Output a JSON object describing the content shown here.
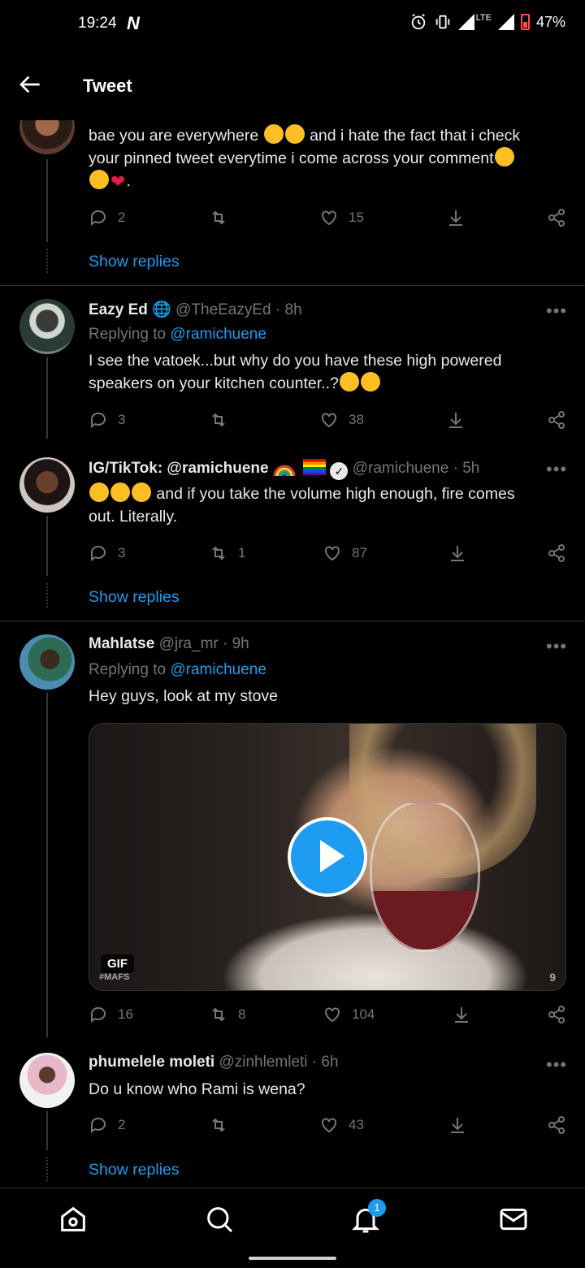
{
  "status_bar": {
    "time": "19:24",
    "network_label": "LTE",
    "battery": "47%"
  },
  "header": {
    "title": "Tweet"
  },
  "colors": {
    "accent": "#1d9bf0",
    "background": "#000000",
    "muted": "#71767b"
  },
  "tweets": [
    {
      "text_line1": "bae you are everywhere",
      "text_line1b": "and i hate the fact that i check",
      "text_line2": "your pinned tweet everytime i come across your comment",
      "text_line3": ".",
      "replies": "2",
      "retweets": "",
      "likes": "15",
      "show_replies": "Show replies"
    },
    {
      "name": "Eazy Ed",
      "handle": "@TheEazyEd",
      "time": "· 8h",
      "replying_prefix": "Replying to",
      "replying_to": "@ramichuene",
      "text": "I see the vatoek...but why do you have these high powered speakers on your kitchen counter..?",
      "replies": "3",
      "retweets": "",
      "likes": "38"
    },
    {
      "name": "IG/TikTok: @ramichuene",
      "handle": "@ramichuene",
      "time": "· 5h",
      "text_line1": "and if you take the volume high enough, fire comes",
      "text_line2": "out. Literally.",
      "replies": "3",
      "retweets": "1",
      "likes": "87",
      "show_replies": "Show replies"
    },
    {
      "name": "Mahlatse",
      "handle": "@jra_mr",
      "time": "· 9h",
      "replying_prefix": "Replying to",
      "replying_to": "@ramichuene",
      "text": "Hey guys, look at my stove",
      "media": {
        "badge": "GIF",
        "caption": "#MAFS",
        "watermark": "9"
      },
      "replies": "16",
      "retweets": "8",
      "likes": "104"
    },
    {
      "name": "phumelele moleti",
      "handle": "@zinhlemleti",
      "time": "· 6h",
      "text": "Do u know who Rami is wena?",
      "replies": "2",
      "retweets": "",
      "likes": "43",
      "show_replies": "Show replies"
    }
  ],
  "more_label": "•••",
  "bottom_nav": {
    "items": [
      "home-icon",
      "search-icon",
      "notifications-icon",
      "messages-icon"
    ],
    "notification_count": "1"
  }
}
